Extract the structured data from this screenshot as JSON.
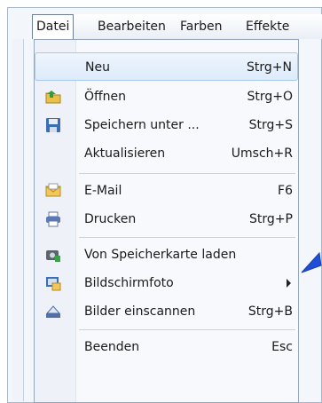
{
  "menubar": {
    "items": [
      "Datei",
      "Bearbeiten",
      "Farben",
      "Effekte"
    ]
  },
  "menu": {
    "items": [
      {
        "label": "Neu",
        "shortcut": "Strg+N",
        "icon": ""
      },
      {
        "label": "Öffnen",
        "shortcut": "Strg+O",
        "icon": "open-folder-icon"
      },
      {
        "label": "Speichern unter ...",
        "shortcut": "Strg+S",
        "icon": "save-disk-icon"
      },
      {
        "label": "Aktualisieren",
        "shortcut": "Umsch+R",
        "icon": ""
      },
      {
        "label": "E-Mail",
        "shortcut": "F6",
        "icon": "email-icon"
      },
      {
        "label": "Drucken",
        "shortcut": "Strg+P",
        "icon": "printer-icon"
      },
      {
        "label": "Von Speicherkarte laden",
        "shortcut": "",
        "icon": "camera-card-icon"
      },
      {
        "label": "Bildschirmfoto",
        "shortcut": "",
        "icon": "screenshot-icon"
      },
      {
        "label": "Bilder einscannen",
        "shortcut": "Strg+B",
        "icon": "scanner-icon"
      },
      {
        "label": "Beenden",
        "shortcut": "Esc",
        "icon": ""
      }
    ]
  },
  "colors": {
    "highlight": "#dcebfb",
    "pointer": "#1f4fd8"
  }
}
